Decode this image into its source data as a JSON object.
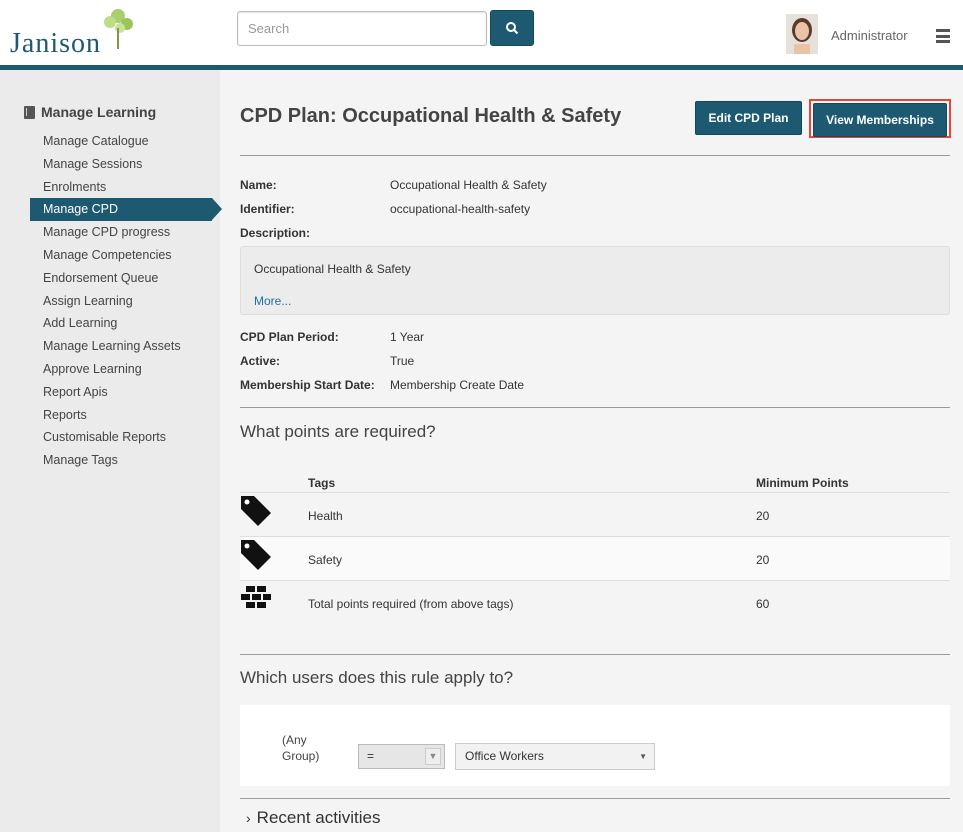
{
  "header": {
    "logo_text": "Janison",
    "search_placeholder": "Search",
    "user_name": "Administrator"
  },
  "sidebar": {
    "title": "Manage Learning",
    "items": [
      {
        "label": "Manage Catalogue"
      },
      {
        "label": "Manage Sessions"
      },
      {
        "label": "Enrolments"
      },
      {
        "label": "Manage CPD",
        "active": true
      },
      {
        "label": "Manage CPD progress"
      },
      {
        "label": "Manage Competencies"
      },
      {
        "label": "Endorsement Queue"
      },
      {
        "label": "Assign Learning"
      },
      {
        "label": "Add Learning"
      },
      {
        "label": "Manage Learning Assets"
      },
      {
        "label": "Approve Learning"
      },
      {
        "label": "Report Apis"
      },
      {
        "label": "Reports"
      },
      {
        "label": "Customisable Reports"
      },
      {
        "label": "Manage Tags"
      }
    ]
  },
  "main": {
    "title": "CPD Plan: Occupational Health & Safety",
    "edit_button": "Edit CPD Plan",
    "view_button": "View Memberships",
    "fields": {
      "name_label": "Name:",
      "name_value": "Occupational Health & Safety",
      "identifier_label": "Identifier:",
      "identifier_value": "occupational-health-safety",
      "description_label": "Description:",
      "description_text": "Occupational Health & Safety",
      "more_link": "More...",
      "period_label": "CPD Plan Period:",
      "period_value": "1 Year",
      "active_label": "Active:",
      "active_value": "True",
      "start_label": "Membership Start Date:",
      "start_value": "Membership Create Date"
    },
    "points_heading": "What points are required?",
    "table": {
      "col_tags": "Tags",
      "col_points": "Minimum Points",
      "rows": [
        {
          "name": "Health",
          "points": "20",
          "icon": "tag-icon"
        },
        {
          "name": "Safety",
          "points": "20",
          "icon": "tag-icon"
        },
        {
          "name": "Total points required (from above tags)",
          "points": "60",
          "icon": "bricks-icon"
        }
      ]
    },
    "users_heading": "Which users does this rule apply to?",
    "rule": {
      "any_group_line1": "(Any",
      "any_group_line2": "Group)",
      "operator": "=",
      "group": "Office Workers"
    },
    "recent_activities": "Recent activities"
  },
  "colors": {
    "accent": "#1d5a72",
    "highlight_border": "#e3473c",
    "link": "#1d6fa5"
  }
}
